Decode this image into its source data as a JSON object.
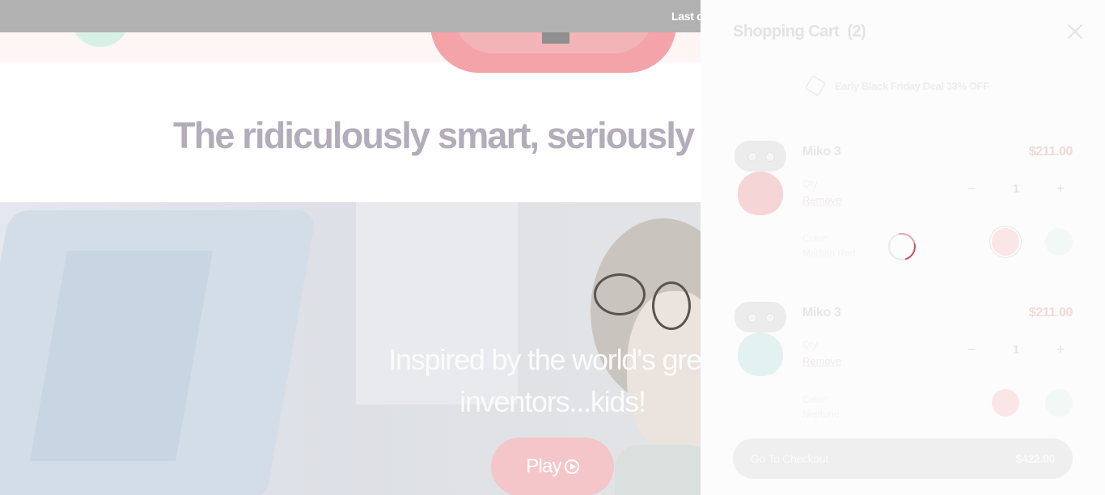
{
  "announcement": {
    "text": "Last c"
  },
  "hero": {
    "tagline": "The ridiculously smart, seriously"
  },
  "video": {
    "line1": "Inspired by the world's grea",
    "line2": "inventors...kids!",
    "play_label": "Play",
    "play_icon": "play-circle-icon"
  },
  "cart": {
    "title": "Shopping Cart",
    "count": "(2)",
    "close_icon": "close-icon",
    "deal_icon": "box-icon",
    "deal_text": "Early Black Friday Deal 33% OFF",
    "items": [
      {
        "name": "Miko 3",
        "price": "$211.00",
        "qty_label": "Qty",
        "quantity": "1",
        "minus": "−",
        "plus": "+",
        "remove_label": "Remove",
        "color_label": "Color:",
        "color_value": "Martian Red",
        "swatches": [
          "#fbe6e7",
          "#f2f8f6"
        ]
      },
      {
        "name": "Miko 3",
        "price": "$211.00",
        "qty_label": "Qty",
        "quantity": "1",
        "minus": "−",
        "plus": "+",
        "remove_label": "Remove",
        "color_label": "Color:",
        "color_value": "Neptune",
        "swatches": [
          "#fbe6e7",
          "#f2f8f6"
        ]
      }
    ],
    "checkout_label": "Go To Checkout",
    "checkout_total": "$422.00"
  }
}
